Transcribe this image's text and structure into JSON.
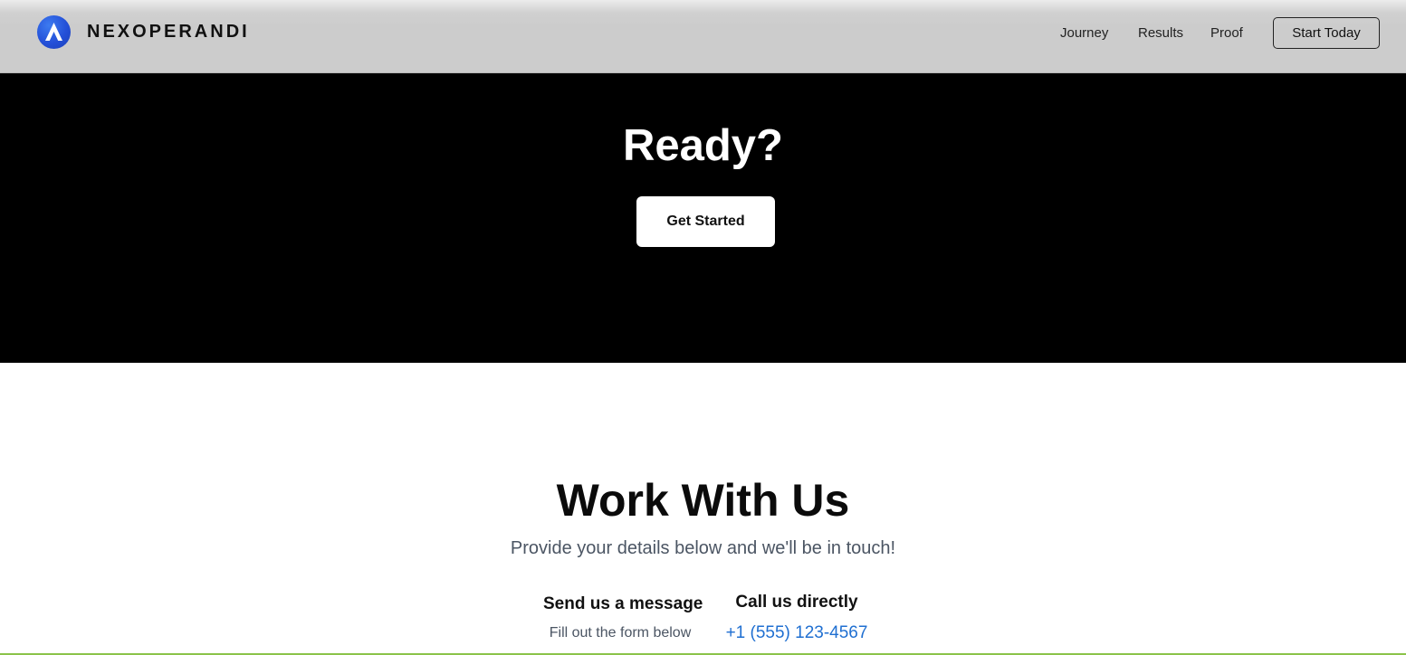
{
  "header": {
    "brand_name": "NEXOPERANDI",
    "logo_icon": "logo-mountain-icon",
    "nav_links": [
      "Journey",
      "Results",
      "Proof"
    ],
    "cta_label": "Start Today"
  },
  "hero": {
    "title": "Ready?",
    "button_label": "Get Started"
  },
  "work": {
    "title": "Work With Us",
    "subtitle": "Provide your details below and we'll be in touch!",
    "message": {
      "heading": "Send us a message",
      "note": "Fill out the form below"
    },
    "call": {
      "heading": "Call us directly",
      "phone": "+1 (555) 123-4567"
    }
  },
  "colors": {
    "accent_blue": "#2450d8",
    "phone_link": "#1f6fd1",
    "hero_bg": "#000000",
    "nav_bg": "#cccccc",
    "bottom_line": "#8bc34a"
  }
}
